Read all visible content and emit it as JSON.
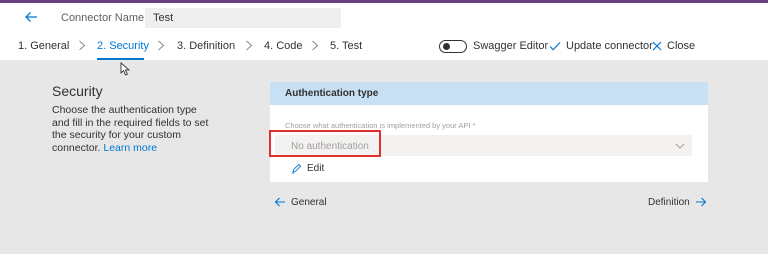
{
  "colors": {
    "accent": "#0078d4",
    "brand_strip": "#6b3f7d",
    "highlight_box": "#e03030",
    "card_header": "#c7e0f4"
  },
  "header": {
    "back_icon": "arrow-left-icon",
    "connector_name_label": "Connector Name",
    "connector_name_value": "Test"
  },
  "steps": [
    {
      "label": "1. General"
    },
    {
      "label": "2. Security"
    },
    {
      "label": "3. Definition"
    },
    {
      "label": "4. Code"
    },
    {
      "label": "5. Test"
    }
  ],
  "active_step": "2. Security",
  "toolbar": {
    "swagger_label": "Swagger Editor",
    "swagger_toggle_on": false,
    "update_label": "Update connector",
    "update_icon": "checkmark-icon",
    "close_label": "Close",
    "close_icon": "close-icon"
  },
  "side": {
    "title": "Security",
    "description": "Choose the authentication type and fill in the required fields to set the security for your custom connector.",
    "learn_more": "Learn more"
  },
  "auth_card": {
    "header": "Authentication type",
    "hint": "Choose what authentication is implemented by your API *",
    "selected": "No authentication",
    "edit_label": "Edit"
  },
  "footer": {
    "prev_label": "General",
    "next_label": "Definition"
  }
}
